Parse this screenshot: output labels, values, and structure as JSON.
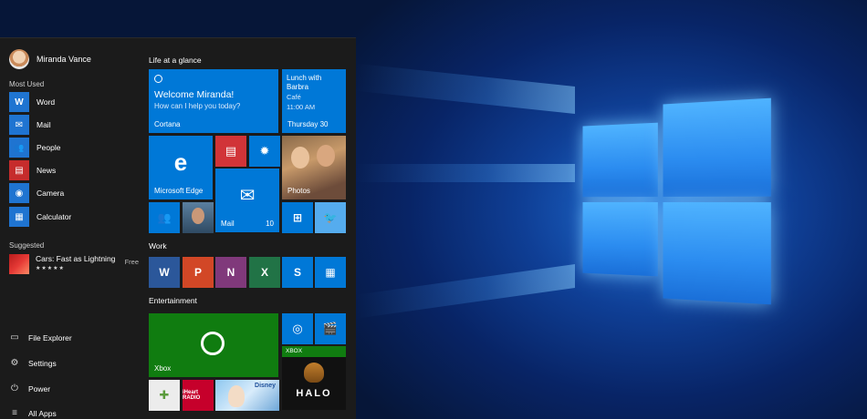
{
  "start_menu": {
    "user": {
      "name": "Miranda Vance"
    },
    "sections": {
      "most_used_label": "Most Used",
      "suggested_label": "Suggested"
    },
    "most_used": [
      {
        "label": "Word",
        "icon": "word-icon",
        "glyph": "W"
      },
      {
        "label": "Mail",
        "icon": "mail-icon",
        "glyph": "✉"
      },
      {
        "label": "People",
        "icon": "people-icon",
        "glyph": "👥"
      },
      {
        "label": "News",
        "icon": "news-icon",
        "glyph": "▤"
      },
      {
        "label": "Camera",
        "icon": "camera-icon",
        "glyph": "◉"
      },
      {
        "label": "Calculator",
        "icon": "calculator-icon",
        "glyph": "▦"
      }
    ],
    "suggested": {
      "title": "Cars: Fast as Lightning",
      "rating": "★★★★★",
      "price": "Free"
    },
    "bottom": [
      {
        "label": "File Explorer",
        "icon": "folder-icon",
        "glyph": "▭"
      },
      {
        "label": "Settings",
        "icon": "gear-icon",
        "glyph": "⚙"
      },
      {
        "label": "Power",
        "icon": "power-icon",
        "glyph": "⏻"
      },
      {
        "label": "All Apps",
        "icon": "list-icon",
        "glyph": "≡"
      }
    ],
    "groups": {
      "life": "Life at a glance",
      "work": "Work",
      "entertainment": "Entertainment"
    },
    "tiles": {
      "cortana": {
        "headline": "Welcome Miranda!",
        "sub": "How can I help you today?",
        "label": "Cortana"
      },
      "calendar": {
        "line1": "Lunch with",
        "line2": "Barbra",
        "line3": "Café",
        "line4": "11:00 AM",
        "date": "Thursday 30"
      },
      "edge": {
        "label": "Microsoft Edge"
      },
      "photos": {
        "label": "Photos"
      },
      "mail": {
        "label": "Mail",
        "count": "10"
      },
      "xbox": {
        "label": "Xbox"
      },
      "xbox_banner": {
        "label": "XBOX"
      },
      "halo": {
        "label": "HALO"
      },
      "store_small": {
        "label": "iHeart RADIO"
      },
      "disney": {
        "label": "Disney"
      }
    }
  },
  "colors": {
    "tile_blue": "#0078d7",
    "tile_red": "#d13438",
    "tile_green": "#107c10",
    "menu_bg": "#1b1b1b"
  }
}
